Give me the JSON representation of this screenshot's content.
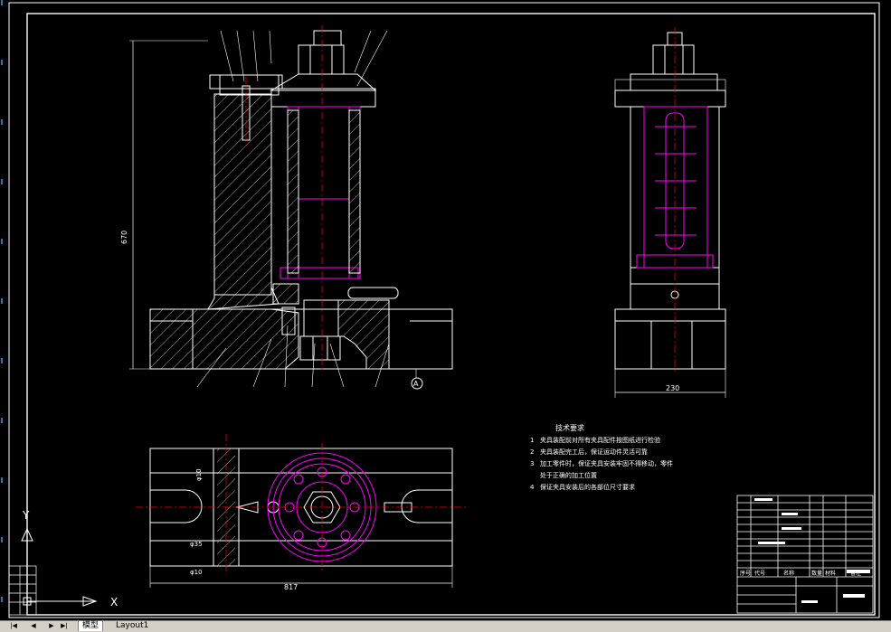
{
  "drawing": {
    "dim_height": "670",
    "dim_side_width": "230",
    "dim_plan_width": "817",
    "section_marker": "A",
    "plan_dims": [
      "φ10",
      "φ35",
      "φ10"
    ]
  },
  "technical_requirements": {
    "title": "技术要求",
    "items": [
      {
        "num": "1",
        "text": "夹具装配前对所有夹具配件按图纸进行检验"
      },
      {
        "num": "2",
        "text": "夹具装配完工后，保证运动件灵活可靠"
      },
      {
        "num": "3",
        "text": "加工零件时，保证夹具安装牢固不得移动，零件"
      },
      {
        "num": "",
        "text": "处于正确的加工位置"
      },
      {
        "num": "4",
        "text": "保证夹具安装后的各部位尺寸要求"
      }
    ]
  },
  "title_block": {
    "header": [
      "序号",
      "代号",
      "名称",
      "数量",
      "材料",
      "备注"
    ]
  },
  "ucs": {
    "x_label": "X",
    "y_label": "Y"
  },
  "tabs": [
    {
      "label": "模型",
      "active": true
    },
    {
      "label": "Layout1",
      "active": false
    }
  ],
  "colors": {
    "background": "#000000",
    "line": "#ffffff",
    "accent": "#ff00ff",
    "center": "#ff0000",
    "hatch": "#cfcfcf"
  }
}
